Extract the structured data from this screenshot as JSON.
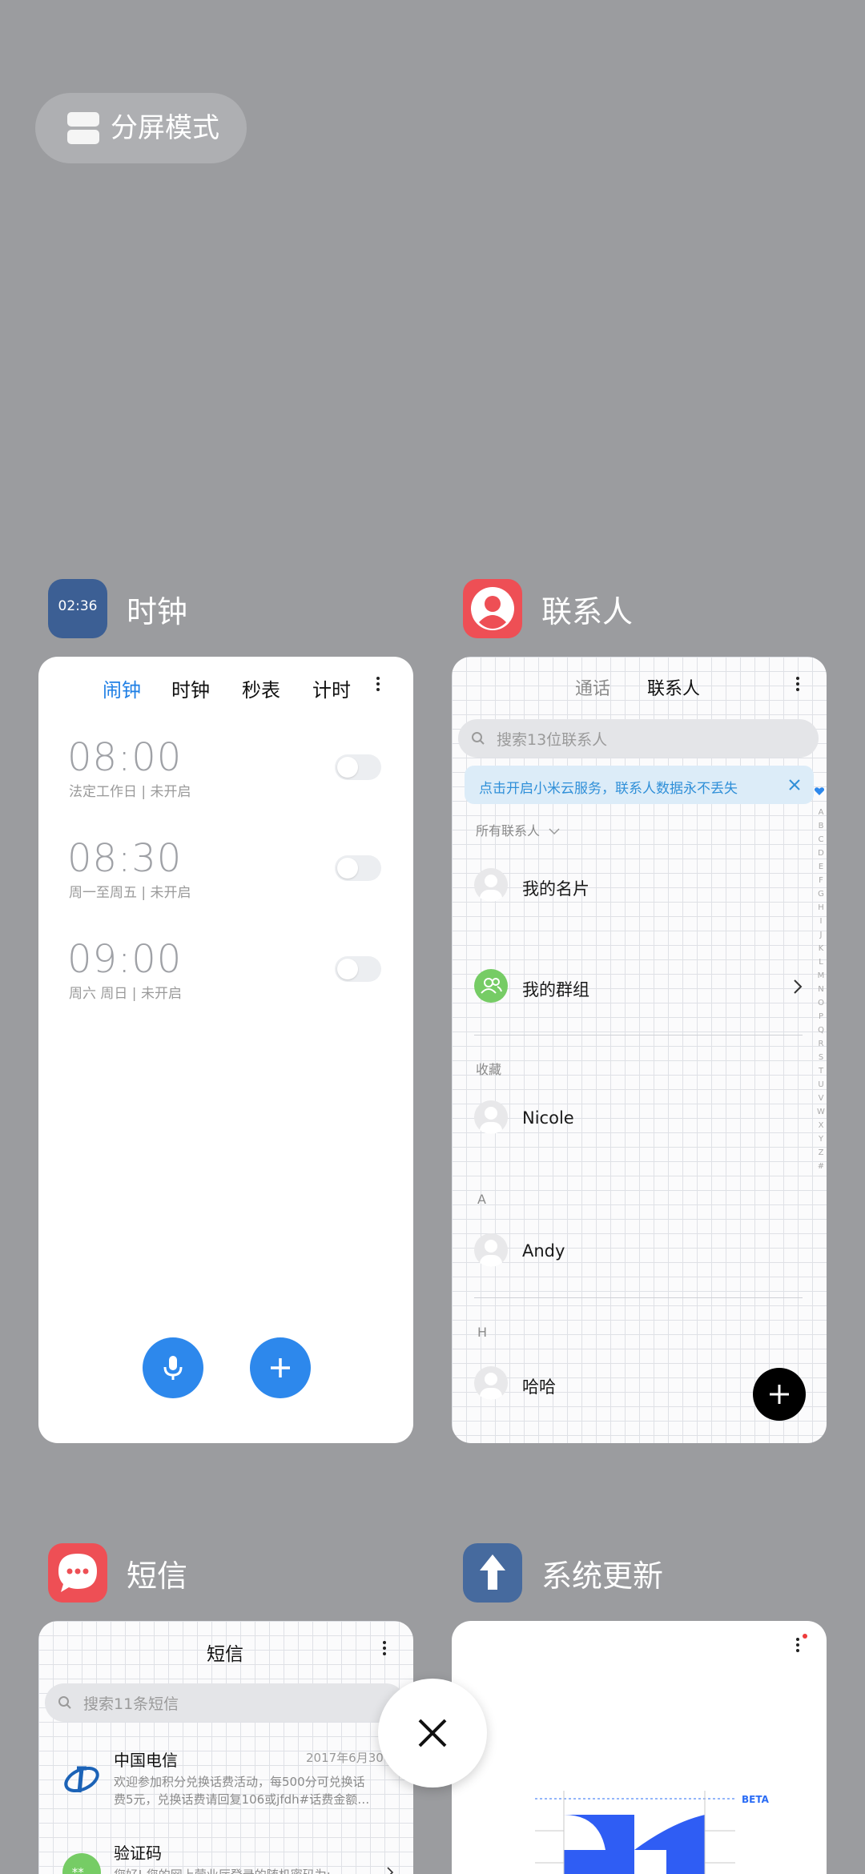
{
  "split_screen": {
    "label": "分屏模式"
  },
  "clock_app": {
    "title": "时钟",
    "icon_time": "02:36",
    "tabs": [
      "闹钟",
      "时钟",
      "秒表",
      "计时"
    ],
    "alarms": [
      {
        "time": "08:00",
        "detail": "法定工作日 | 未开启"
      },
      {
        "time": "08:30",
        "detail": "周一至周五 | 未开启"
      },
      {
        "time": "09:00",
        "detail": "周六 周日 | 未开启"
      }
    ]
  },
  "contacts_app": {
    "title": "联系人",
    "tabs": [
      "通话",
      "联系人"
    ],
    "search_placeholder": "搜索13位联系人",
    "cloud_banner": "点击开启小米云服务，联系人数据永不丢失",
    "all_contacts": "所有联系人",
    "my_card": "我的名片",
    "my_groups": "我的群组",
    "favorites_header": "收藏",
    "contacts": [
      {
        "section": "",
        "name": "Nicole"
      },
      {
        "section": "A",
        "name": "Andy"
      },
      {
        "section": "H",
        "name": "哈哈"
      }
    ],
    "alphabet": [
      "A",
      "B",
      "C",
      "D",
      "E",
      "F",
      "G",
      "H",
      "I",
      "J",
      "K",
      "L",
      "M",
      "N",
      "O",
      "P",
      "Q",
      "R",
      "S",
      "T",
      "U",
      "V",
      "W",
      "X",
      "Y",
      "Z",
      "#"
    ]
  },
  "messages_app": {
    "title": "短信",
    "header": "短信",
    "search_placeholder": "搜索11条短信",
    "threads": [
      {
        "sender": "中国电信",
        "date": "2017年6月30",
        "preview_line1": "欢迎参加积分兑换话费活动，每500分可兑换话",
        "preview_line2": "费5元，兑换话费请回复106或jfdh#话费金额…"
      },
      {
        "sender": "验证码",
        "date": "",
        "preview_line1": "您好! 您的网上营业厅登录的随机密码为:",
        "preview_line2": ""
      }
    ]
  },
  "update_app": {
    "title": "系统更新",
    "beta_label": "BETA"
  },
  "colors": {
    "accent_blue": "#2d88ec",
    "contacts_red": "#ee4f55",
    "clock_icon": "#3c5f94"
  }
}
